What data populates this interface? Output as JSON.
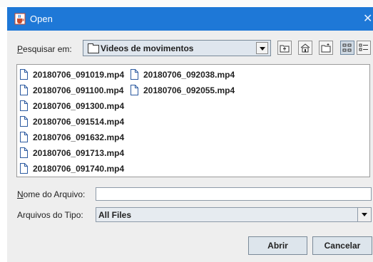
{
  "window": {
    "title": "Open",
    "icon": "java-cup-icon",
    "close_glyph": "✕"
  },
  "search": {
    "label": "Pesquisar em:",
    "folder_icon": "folder-icon",
    "folder": "Videos de movimentos"
  },
  "toolbar": {
    "buttons": [
      {
        "name": "up-one-level-icon"
      },
      {
        "name": "home-icon"
      },
      {
        "name": "new-folder-icon"
      },
      {
        "name": "list-view-icon",
        "active": true
      },
      {
        "name": "details-view-icon"
      }
    ]
  },
  "files": [
    "20180706_091019.mp4",
    "20180706_092038.mp4",
    "20180706_091100.mp4",
    "20180706_092055.mp4",
    "20180706_091300.mp4",
    "20180706_091514.mp4",
    "20180706_091632.mp4",
    "20180706_091713.mp4",
    "20180706_091740.mp4"
  ],
  "filename": {
    "label": "Nome do Arquivo:",
    "value": ""
  },
  "filetype": {
    "label": "Arquivos do Tipo:",
    "value": "All Files"
  },
  "buttons": {
    "open": "Abrir",
    "cancel": "Cancelar"
  },
  "colors": {
    "titlebar": "#1e78d7",
    "dialog": "#eeeeee",
    "button": "#dde5ec"
  }
}
